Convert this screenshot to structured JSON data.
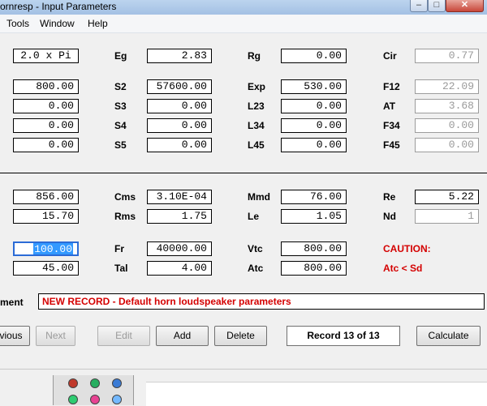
{
  "window": {
    "title": "ornresp - Input Parameters"
  },
  "menu": [
    "Tools",
    "Window",
    "Help"
  ],
  "rows": [
    {
      "a": "2.0 x Pi",
      "b_label": "Eg",
      "b": "2.83",
      "c_label": "Rg",
      "c": "0.00",
      "d_label": "Cir",
      "d": "0.77"
    },
    {
      "a": "800.00",
      "b_label": "S2",
      "b": "57600.00",
      "c_label": "Exp",
      "c": "530.00",
      "d_label": "F12",
      "d": "22.09"
    },
    {
      "a": "0.00",
      "b_label": "S3",
      "b": "0.00",
      "c_label": "L23",
      "c": "0.00",
      "d_label": "AT",
      "d": "3.68"
    },
    {
      "a": "0.00",
      "b_label": "S4",
      "b": "0.00",
      "c_label": "L34",
      "c": "0.00",
      "d_label": "F34",
      "d": "0.00"
    },
    {
      "a": "0.00",
      "b_label": "S5",
      "b": "0.00",
      "c_label": "L45",
      "c": "0.00",
      "d_label": "F45",
      "d": "0.00"
    },
    {
      "a": "856.00",
      "b_label": "Cms",
      "b": "3.10E-04",
      "c_label": "Mmd",
      "c": "76.00",
      "d_label": "Re",
      "d": "5.22"
    },
    {
      "a": "15.70",
      "b_label": "Rms",
      "b": "1.75",
      "c_label": "Le",
      "c": "1.05",
      "d_label": "Nd",
      "d": "1"
    },
    {
      "a": "100.00",
      "b_label": "Fr",
      "b": "40000.00",
      "c_label": "Vtc",
      "c": "800.00",
      "d_label": "CAUTION:"
    },
    {
      "a": "45.00",
      "b_label": "Tal",
      "b": "4.00",
      "c_label": "Atc",
      "c": "800.00",
      "d_label": "Atc < Sd"
    }
  ],
  "comment": {
    "label": "ment",
    "value": "NEW RECORD - Default horn loudspeaker parameters"
  },
  "buttons": {
    "previous": "vious",
    "next": "Next",
    "edit": "Edit",
    "add": "Add",
    "delete": "Delete",
    "record": "Record 13 of 13",
    "calculate": "Calculate"
  },
  "colors": {
    "warning": "#d40000",
    "selection": "#3399ff"
  }
}
